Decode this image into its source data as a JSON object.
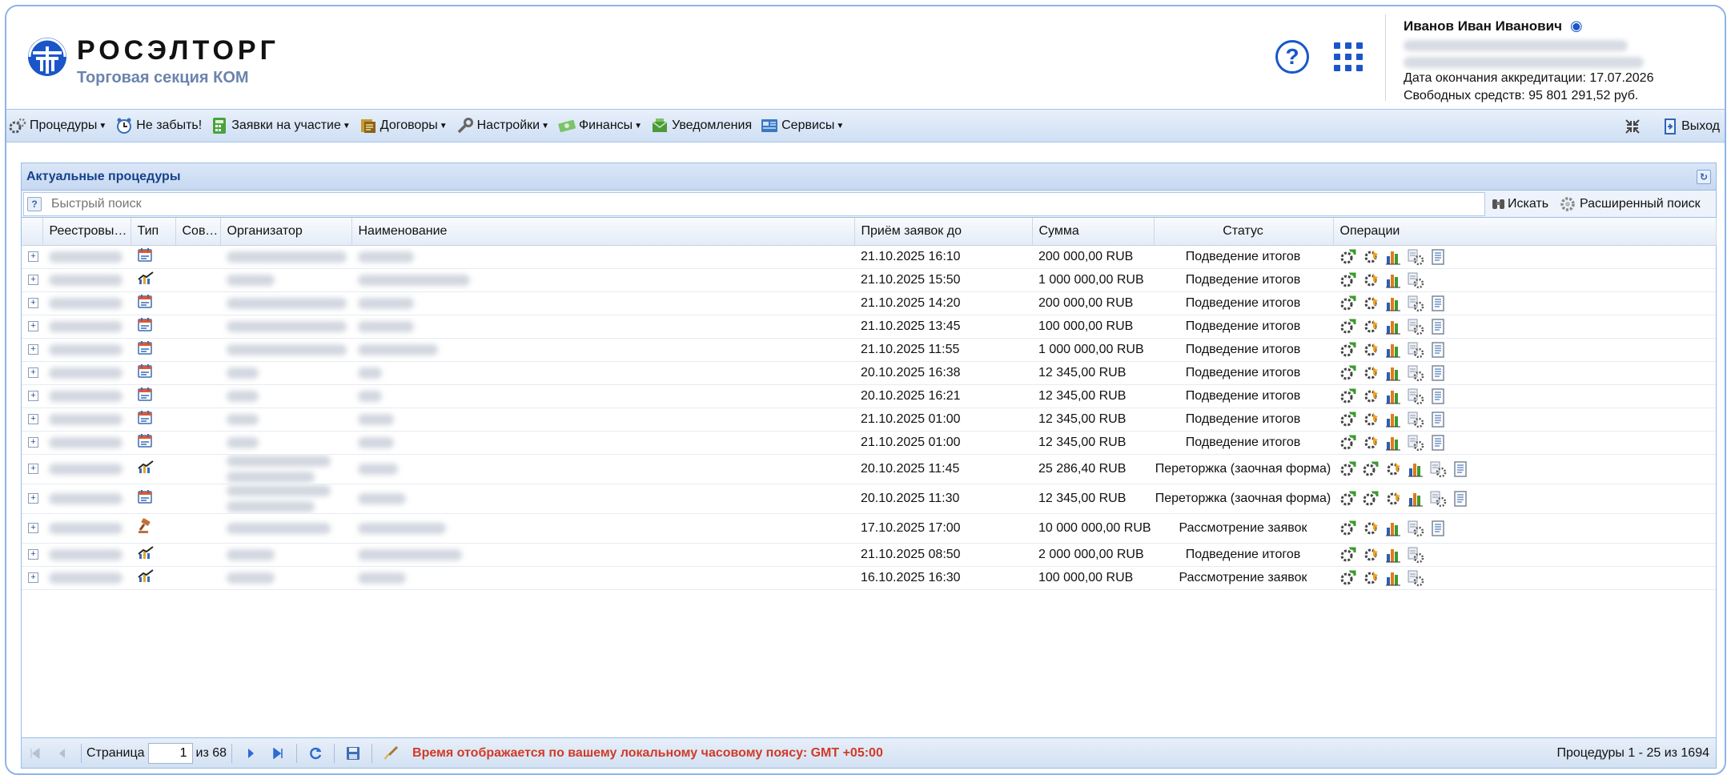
{
  "header": {
    "brand": "РОСЭЛТОРГ",
    "section": "Торговая секция КОМ",
    "user": {
      "name": "Иванов Иван Иванович",
      "accreditation": "Дата окончания аккредитации: 17.07.2026",
      "funds": "Свободных средств: 95 801 291,52 руб."
    }
  },
  "menu": {
    "items": [
      {
        "label": "Процедуры",
        "dropdown": true,
        "icon": "gears-icon"
      },
      {
        "label": "Не забыть!",
        "dropdown": false,
        "icon": "clock-icon"
      },
      {
        "label": "Заявки на участие",
        "dropdown": true,
        "icon": "calculator-icon"
      },
      {
        "label": "Договоры",
        "dropdown": true,
        "icon": "contract-icon"
      },
      {
        "label": "Настройки",
        "dropdown": true,
        "icon": "wrench-icon"
      },
      {
        "label": "Финансы",
        "dropdown": true,
        "icon": "money-icon"
      },
      {
        "label": "Уведомления",
        "dropdown": false,
        "icon": "notification-icon"
      },
      {
        "label": "Сервисы",
        "dropdown": true,
        "icon": "services-icon"
      }
    ],
    "exit_label": "Выход"
  },
  "panel": {
    "title": "Актуальные процедуры",
    "search_placeholder": "Быстрый поиск",
    "search_button": "Искать",
    "advanced_button": "Расширенный поиск",
    "columns": [
      "Реестровый №",
      "Тип",
      "Совм…",
      "Организатор",
      "Наименование",
      "Приём заявок до",
      "Сумма",
      "Статус",
      "Операции"
    ]
  },
  "rows": [
    {
      "type": "calendar",
      "deadline": "21.10.2025 16:10",
      "sum": "200 000,00 RUB",
      "status": "Подведение итогов",
      "ops": 5,
      "org_w": 150,
      "name_w": 70
    },
    {
      "type": "chart",
      "deadline": "21.10.2025 15:50",
      "sum": "1 000 000,00 RUB",
      "status": "Подведение итогов",
      "ops": 4,
      "org_w": 60,
      "name_w": 140
    },
    {
      "type": "calendar",
      "deadline": "21.10.2025 14:20",
      "sum": "200 000,00 RUB",
      "status": "Подведение итогов",
      "ops": 5,
      "org_w": 150,
      "name_w": 70
    },
    {
      "type": "calendar",
      "deadline": "21.10.2025 13:45",
      "sum": "100 000,00 RUB",
      "status": "Подведение итогов",
      "ops": 5,
      "org_w": 150,
      "name_w": 70
    },
    {
      "type": "calendar",
      "deadline": "21.10.2025 11:55",
      "sum": "1 000 000,00 RUB",
      "status": "Подведение итогов",
      "ops": 5,
      "org_w": 150,
      "name_w": 100
    },
    {
      "type": "calendar",
      "deadline": "20.10.2025 16:38",
      "sum": "12 345,00 RUB",
      "status": "Подведение итогов",
      "ops": 5,
      "org_w": 40,
      "name_w": 30
    },
    {
      "type": "calendar",
      "deadline": "20.10.2025 16:21",
      "sum": "12 345,00 RUB",
      "status": "Подведение итогов",
      "ops": 5,
      "org_w": 40,
      "name_w": 30
    },
    {
      "type": "calendar",
      "deadline": "21.10.2025 01:00",
      "sum": "12 345,00 RUB",
      "status": "Подведение итогов",
      "ops": 5,
      "org_w": 40,
      "name_w": 45
    },
    {
      "type": "calendar",
      "deadline": "21.10.2025 01:00",
      "sum": "12 345,00 RUB",
      "status": "Подведение итогов",
      "ops": 5,
      "org_w": 40,
      "name_w": 45
    },
    {
      "type": "chart",
      "deadline": "20.10.2025 11:45",
      "sum": "25 286,40 RUB",
      "status": "Переторжка (заочная форма)",
      "ops": 6,
      "org_w": 130,
      "name_w": 50
    },
    {
      "type": "calendar",
      "deadline": "20.10.2025 11:30",
      "sum": "12 345,00 RUB",
      "status": "Переторжка (заочная форма)",
      "ops": 6,
      "org_w": 130,
      "name_w": 60
    },
    {
      "type": "auction",
      "deadline": "17.10.2025 17:00",
      "sum": "10 000 000,00 RUB",
      "status": "Рассмотрение заявок",
      "ops": 5,
      "org_w": 130,
      "name_w": 110
    },
    {
      "type": "chart",
      "deadline": "21.10.2025 08:50",
      "sum": "2 000 000,00 RUB",
      "status": "Подведение итогов",
      "ops": 4,
      "org_w": 60,
      "name_w": 130
    },
    {
      "type": "chart",
      "deadline": "16.10.2025 16:30",
      "sum": "100 000,00 RUB",
      "status": "Рассмотрение заявок",
      "ops": 4,
      "org_w": 60,
      "name_w": 60
    }
  ],
  "paging": {
    "page_label": "Страница",
    "page": "1",
    "of_label": "из 68",
    "timezone_note": "Время отображается по вашему локальному часовому поясу: GMT +05:00",
    "total": "Процедуры 1 - 25 из 1694"
  },
  "colors": {
    "accent": "#1a56c9",
    "panel_title": "#15428b",
    "timezone_note": "#d13a27"
  }
}
